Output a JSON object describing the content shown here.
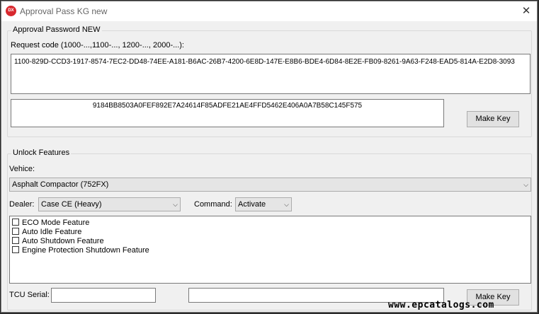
{
  "window": {
    "title": "Approval Pass KG new",
    "icon_label": "DX",
    "close_label": "✕"
  },
  "approval": {
    "group_title": "Approval Password NEW",
    "request_label": "Request code (1000-...,1100-..., 1200-..., 2000-...):",
    "request_code": "1100-829D-CCD3-1917-8574-7EC2-DD48-74EE-A181-B6AC-26B7-4200-6E8D-147E-E8B6-BDE4-6D84-8E2E-FB09-8261-9A63-F248-EAD5-814A-E2D8-3093",
    "key_output": "9184BB8503A0FEF892E7A24614F85ADFE21AE4FFD5462E406A0A7B58C145F575",
    "make_key_label": "Make Key"
  },
  "unlock": {
    "group_title": "Unlock Features",
    "vehicle_label": "Vehice:",
    "vehicle_value": "Asphalt Compactor (752FX)",
    "dealer_label": "Dealer:",
    "dealer_value": "Case CE (Heavy)",
    "command_label": "Command:",
    "command_value": "Activate",
    "features": [
      {
        "label": "ECO Mode Feature",
        "checked": false
      },
      {
        "label": "Auto Idle Feature",
        "checked": false
      },
      {
        "label": "Auto Shutdown Feature",
        "checked": false
      },
      {
        "label": "Engine Protection Shutdown Feature",
        "checked": false
      }
    ],
    "tcu_label": "TCU Serial:",
    "tcu_value": "",
    "key_output": "",
    "make_key_label": "Make Key"
  },
  "watermark": "www.epcatalogs.com"
}
